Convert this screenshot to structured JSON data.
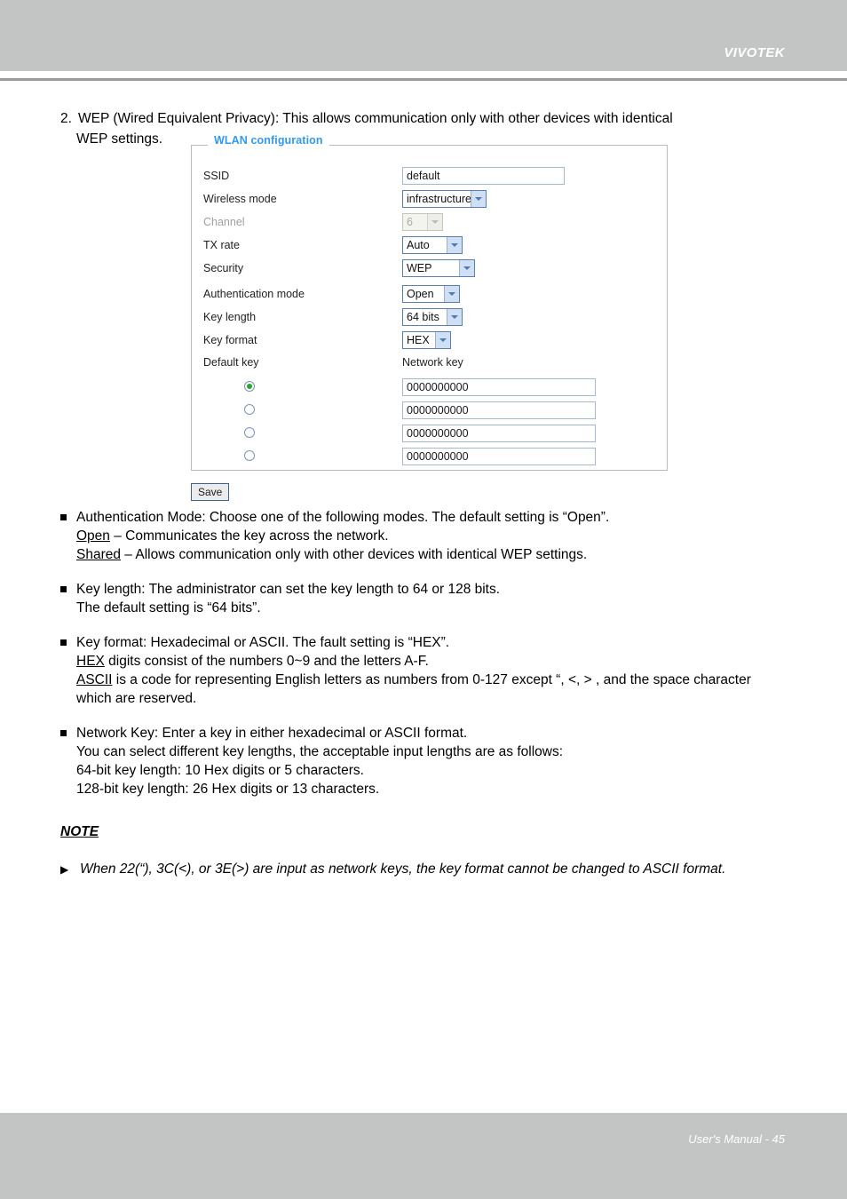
{
  "header": {
    "brand": "VIVOTEK"
  },
  "footer": {
    "text": "User's Manual - 45"
  },
  "intro": {
    "number": "2.",
    "line1": "WEP (Wired Equivalent Privacy): This allows communication only with other devices with identical",
    "line2": "WEP settings."
  },
  "wlan_panel": {
    "legend": "WLAN configuration",
    "fields": [
      {
        "label": "SSID",
        "control": "text",
        "value": "default"
      },
      {
        "label": "Wireless mode",
        "control": "select",
        "value": "infrastructure"
      },
      {
        "label": "Channel",
        "control": "select",
        "value": "6",
        "disabled": true
      },
      {
        "label": "TX rate",
        "control": "select",
        "value": "Auto"
      },
      {
        "label": "Security",
        "control": "select",
        "value": "WEP"
      },
      {
        "label": "Authentication mode",
        "control": "select",
        "value": "Open"
      },
      {
        "label": "Key length",
        "control": "select",
        "value": "64 bits"
      },
      {
        "label": "Key format",
        "control": "select",
        "value": "HEX"
      }
    ],
    "default_key_label": "Default key",
    "network_key_label": "Network key",
    "keys": [
      {
        "selected": true,
        "value": "0000000000"
      },
      {
        "selected": false,
        "value": "0000000000"
      },
      {
        "selected": false,
        "value": "0000000000"
      },
      {
        "selected": false,
        "value": "0000000000"
      }
    ],
    "save_label": "Save",
    "accent_color": "#3399ee"
  },
  "bullets": [
    {
      "line1": "Authentication Mode: Choose one of the following modes. The default setting is “Open”.",
      "sub": [
        {
          "underlined": "Open",
          "rest": " – Communicates the key across the network."
        },
        {
          "underlined": "Shared",
          "rest": " – Allows communication only with other devices with identical WEP settings."
        }
      ]
    },
    {
      "line1": "Key length: The administrator can set the key length to 64 or 128 bits.",
      "sub": [
        {
          "underlined": "",
          "rest": "The default setting is “64 bits”."
        }
      ]
    },
    {
      "line1": "Key format: Hexadecimal or ASCII. The fault setting is “HEX”.",
      "sub": [
        {
          "underlined": "HEX",
          "rest": " digits consist of the numbers 0~9 and the letters A-F."
        },
        {
          "underlined": "ASCII",
          "rest": " is a code for representing English letters as numbers from 0-127 except “, <, > , and the space character which are reserved."
        }
      ]
    },
    {
      "line1": "Network Key: Enter a key in either hexadecimal or ASCII format.",
      "sub": [
        {
          "underlined": "",
          "rest": "You can select different key lengths, the acceptable input lengths are as follows:"
        },
        {
          "underlined": "",
          "rest": "64-bit key length: 10 Hex digits or 5 characters."
        },
        {
          "underlined": "",
          "rest": "128-bit key length: 26 Hex digits or 13 characters."
        }
      ]
    }
  ],
  "note": {
    "heading": "NOTE",
    "body": "When 22(“), 3C(<), or 3E(>) are input as network keys, the key format cannot be changed to ASCII format."
  }
}
